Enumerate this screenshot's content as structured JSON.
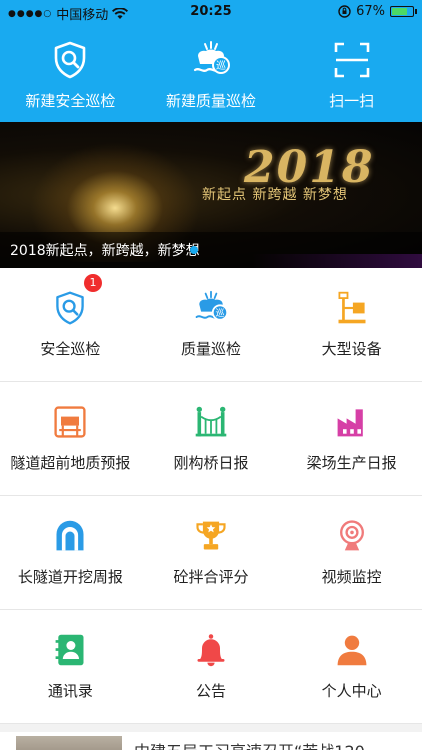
{
  "status_bar": {
    "signal": "●●●●○",
    "carrier": "中国移动",
    "time": "20:25",
    "battery_text": "67%",
    "battery_level": 0.67
  },
  "header": {
    "actions": [
      {
        "label": "新建安全巡检",
        "icon": "shield-search-icon"
      },
      {
        "label": "新建质量巡检",
        "icon": "quality-inspect-icon"
      },
      {
        "label": "扫一扫",
        "icon": "scan-icon"
      }
    ],
    "color": "#19aaf0"
  },
  "banner": {
    "year_text": "2018",
    "slogan": "新起点 新跨越 新梦想",
    "caption": "2018新起点，新跨越，新梦想"
  },
  "grid": {
    "items": [
      {
        "label": "安全巡检",
        "icon": "shield-search-icon",
        "color": "#2a9be6",
        "badge": "1"
      },
      {
        "label": "质量巡检",
        "icon": "quality-inspect-icon",
        "color": "#2a9be6"
      },
      {
        "label": "大型设备",
        "icon": "equipment-icon",
        "color": "#f5a623"
      },
      {
        "label": "隧道超前地质预报",
        "icon": "tunnel-forecast-icon",
        "color": "#f07b3f"
      },
      {
        "label": "刚构桥日报",
        "icon": "bridge-icon",
        "color": "#2bb673"
      },
      {
        "label": "梁场生产日报",
        "icon": "factory-icon",
        "color": "#d63fa6"
      },
      {
        "label": "长隧道开挖周报",
        "icon": "tunnel-icon",
        "color": "#2a9be6"
      },
      {
        "label": "砼拌合评分",
        "icon": "trophy-icon",
        "color": "#f5a623"
      },
      {
        "label": "视频监控",
        "icon": "camera-icon",
        "color": "#f07b7b"
      },
      {
        "label": "通讯录",
        "icon": "contacts-icon",
        "color": "#2bb673"
      },
      {
        "label": "公告",
        "icon": "bell-icon",
        "color": "#f04848"
      },
      {
        "label": "个人中心",
        "icon": "person-icon",
        "color": "#f07b3f"
      }
    ]
  },
  "news": {
    "title": "中建五局工习高速召开“苦战120"
  }
}
